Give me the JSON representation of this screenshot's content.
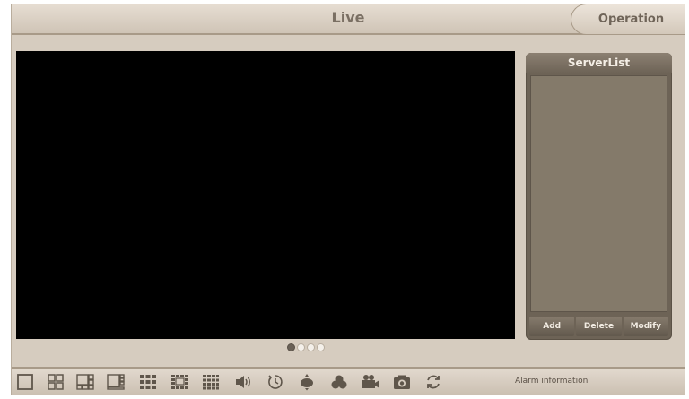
{
  "header": {
    "title": "Live",
    "operation_label": "Operation"
  },
  "server_panel": {
    "title": "ServerList",
    "actions": {
      "add": "Add",
      "delete": "Delete",
      "modify": "Modify"
    }
  },
  "pagination": {
    "pages": 4,
    "current": 1
  },
  "toolbar": {
    "icons": [
      "single-view-icon",
      "four-split-icon",
      "six-split-icon",
      "eight-split-icon",
      "nine-split-icon",
      "thirteen-split-icon",
      "sixteen-split-icon",
      "volume-icon",
      "history-icon",
      "ptz-icon",
      "color-adjust-icon",
      "record-icon",
      "snapshot-icon",
      "refresh-icon"
    ],
    "alarm_label": "Alarm information"
  },
  "colors": {
    "accent": "#6d6356",
    "background": "#d6ccbf",
    "video": "#000000"
  }
}
